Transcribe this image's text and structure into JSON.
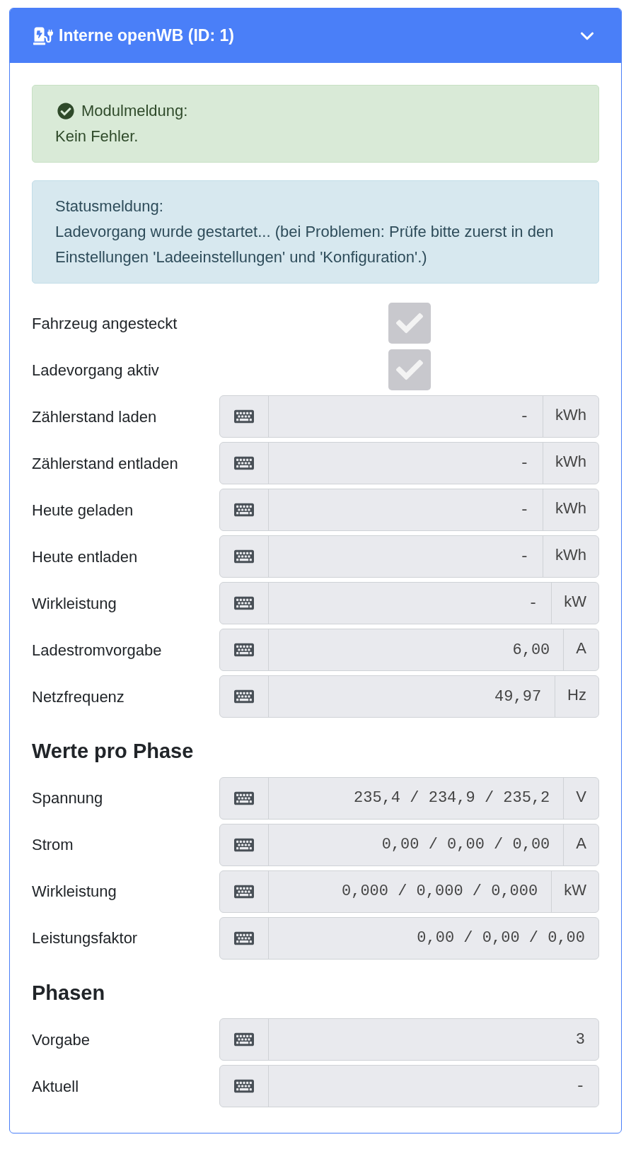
{
  "card": {
    "title": "Interne openWB (ID: 1)",
    "expanded": true
  },
  "alerts": [
    {
      "kind": "success",
      "title": "Modulmeldung:",
      "text": "Kein Fehler."
    },
    {
      "kind": "info",
      "title": "Statusmeldung:",
      "text": "Ladevorgang wurde gestartet... (bei Problemen: Prüfe bitte zuerst in den Einstellungen 'Ladeeinstellungen' und 'Konfiguration'.)"
    }
  ],
  "sections": [
    {
      "items": [
        {
          "kind": "checkbox",
          "label": "Fahrzeug angesteckt",
          "checked": true
        },
        {
          "kind": "checkbox",
          "label": "Ladevorgang aktiv",
          "checked": true
        },
        {
          "kind": "field",
          "label": "Zählerstand laden",
          "value": "-",
          "unit": "kWh"
        },
        {
          "kind": "field",
          "label": "Zählerstand entladen",
          "value": "-",
          "unit": "kWh"
        },
        {
          "kind": "field",
          "label": "Heute geladen",
          "value": "-",
          "unit": "kWh"
        },
        {
          "kind": "field",
          "label": "Heute entladen",
          "value": "-",
          "unit": "kWh"
        },
        {
          "kind": "field",
          "label": "Wirkleistung",
          "value": "-",
          "unit": "kW"
        },
        {
          "kind": "field",
          "label": "Ladestromvorgabe",
          "value": "6,00",
          "unit": "A"
        },
        {
          "kind": "field",
          "label": "Netzfrequenz",
          "value": "49,97",
          "unit": "Hz"
        }
      ]
    },
    {
      "heading": "Werte pro Phase",
      "items": [
        {
          "kind": "field",
          "label": "Spannung",
          "value": "235,4 / 234,9 / 235,2",
          "unit": "V"
        },
        {
          "kind": "field",
          "label": "Strom",
          "value": "0,00 / 0,00 / 0,00",
          "unit": "A"
        },
        {
          "kind": "field",
          "label": "Wirkleistung",
          "value": "0,000 / 0,000 / 0,000",
          "unit": "kW"
        },
        {
          "kind": "field",
          "label": "Leistungsfaktor",
          "value": "0,00 / 0,00 / 0,00"
        }
      ]
    },
    {
      "heading": "Phasen",
      "items": [
        {
          "kind": "field",
          "label": "Vorgabe",
          "value": "3"
        },
        {
          "kind": "field",
          "label": "Aktuell",
          "value": "-"
        }
      ]
    }
  ]
}
